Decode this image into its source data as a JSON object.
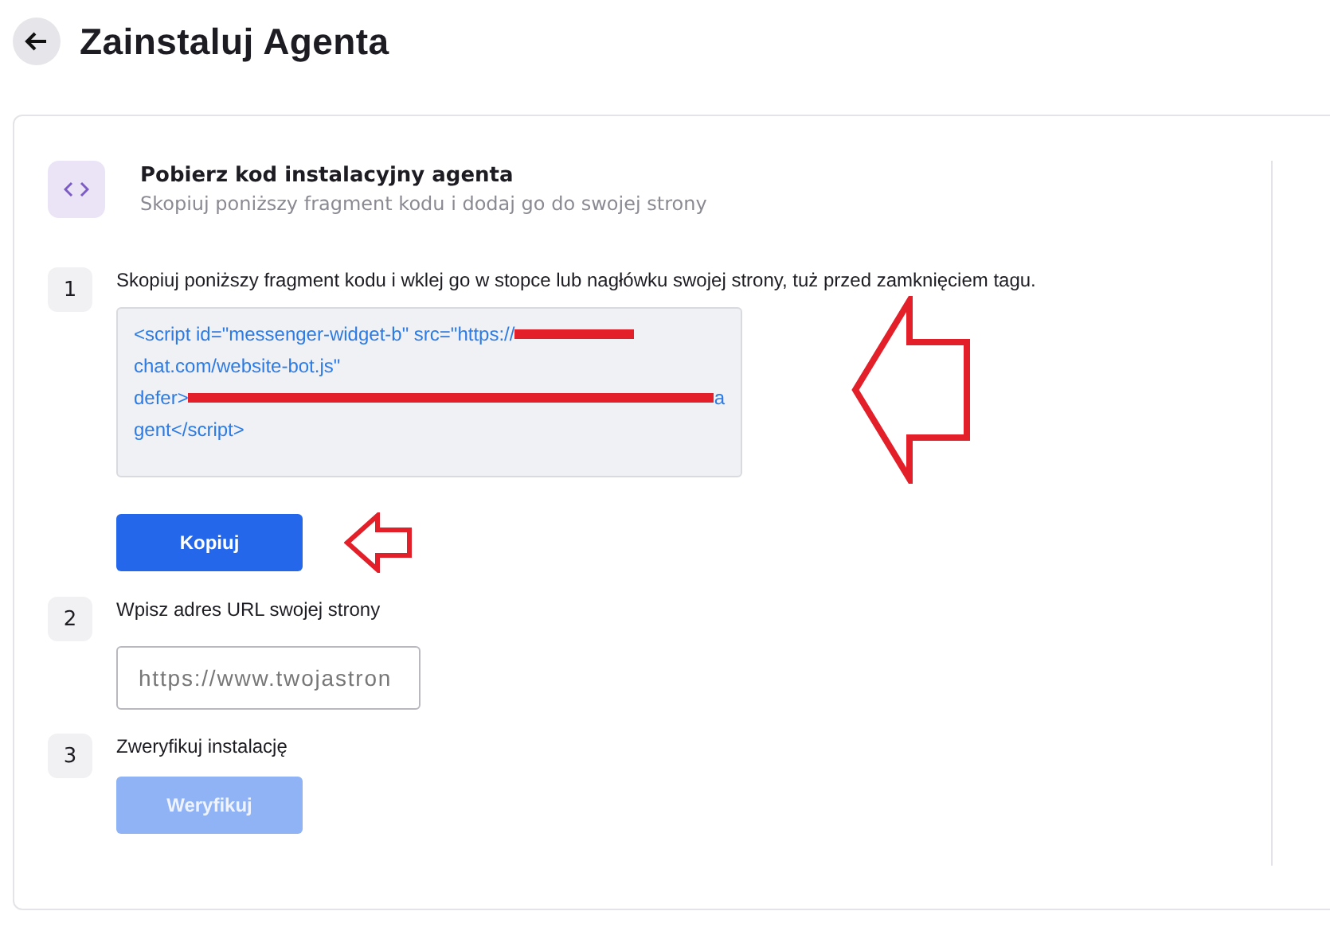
{
  "page": {
    "title": "Zainstaluj Agenta"
  },
  "section": {
    "title": "Pobierz kod instalacyjny agenta",
    "subtitle": "Skopiuj poniższy fragment kodu i dodaj go do swojej strony"
  },
  "steps": [
    {
      "number": "1",
      "kind": "code",
      "label": "Skopiuj poniższy fragment kodu i wklej go w stopce lub nagłówku swojej strony, tuż przed zamknięciem tagu.",
      "code_lines": [
        {
          "parts": [
            {
              "kind": "text",
              "text": "<script id=\"messenger-widget-b\" src=\"https://"
            },
            {
              "kind": "redaction",
              "wide": false
            }
          ]
        },
        {
          "parts": [
            {
              "kind": "text",
              "text": "chat.com/website-bot.js\""
            }
          ]
        },
        {
          "parts": [
            {
              "kind": "text",
              "text": "defer>"
            },
            {
              "kind": "redaction",
              "wide": true
            },
            {
              "kind": "text",
              "text": "a"
            }
          ]
        },
        {
          "parts": [
            {
              "kind": "text",
              "text": "gent</script>"
            }
          ]
        }
      ],
      "button": {
        "label": "Kopiuj",
        "disabled": false
      }
    },
    {
      "number": "2",
      "kind": "input",
      "label": "Wpisz adres URL swojej strony",
      "placeholder": "https://www.twojastron"
    },
    {
      "number": "3",
      "kind": "button",
      "label": "Zweryfikuj instalację",
      "button": {
        "label": "Weryfikuj",
        "disabled": true
      }
    }
  ],
  "annotations": [
    {
      "kind": "arrow",
      "large": true
    },
    {
      "kind": "arrow",
      "large": false
    }
  ]
}
